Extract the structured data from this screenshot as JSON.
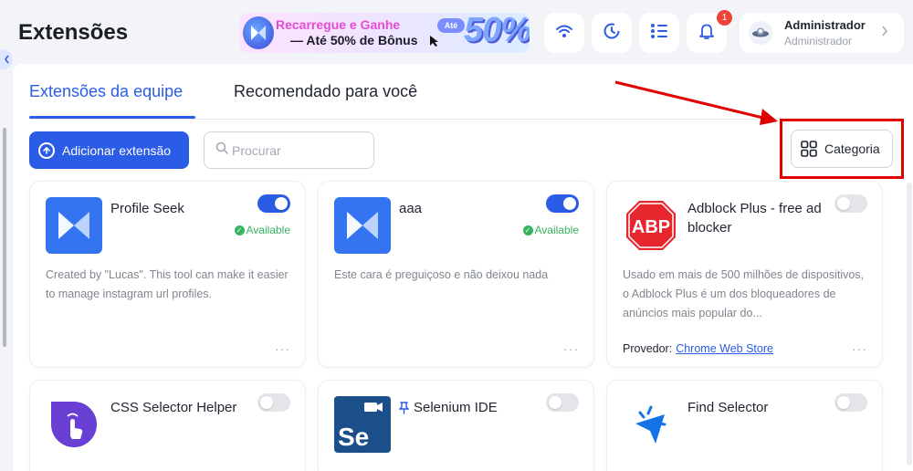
{
  "header": {
    "title": "Extensões",
    "promo": {
      "line1": "Recarregue e Ganhe",
      "line2": "— Até 50% de Bônus",
      "badge": "Até",
      "big": "50%"
    },
    "notification_count": "1",
    "user": {
      "name": "Administrador",
      "role": "Administrador"
    },
    "icons": [
      "wifi-icon",
      "sync-icon",
      "list-icon",
      "bell-icon"
    ]
  },
  "tabs": [
    {
      "label": "Extensões da equipe",
      "active": true
    },
    {
      "label": "Recomendado para você",
      "active": false
    }
  ],
  "toolbar": {
    "add_label": "Adicionar extensão",
    "search_placeholder": "Procurar",
    "category_label": "Categoria"
  },
  "cards": [
    {
      "name": "Profile Seek",
      "enabled": true,
      "status": "Available",
      "description": "Created by \"Lucas\". This tool can make it easier to manage instagram url profiles.",
      "more": "···"
    },
    {
      "name": "aaa",
      "enabled": true,
      "status": "Available",
      "description": "Este cara é preguiçoso e não deixou nada",
      "more": "···"
    },
    {
      "name": "Adblock Plus - free ad blocker",
      "enabled": false,
      "description": "Usado em mais de 500 milhões de dispositivos, o Adblock Plus é um dos bloqueadores de anúncios mais popular do...",
      "provider_label": "Provedor:",
      "provider_value": "Chrome Web Store",
      "logo_text": "ABP",
      "more": "···"
    },
    {
      "name": "CSS Selector Helper",
      "enabled": false
    },
    {
      "name": "Selenium IDE",
      "enabled": false,
      "logo_text": "Se"
    },
    {
      "name": "Find Selector",
      "enabled": false
    }
  ],
  "colors": {
    "accent": "#2b5ce6",
    "available": "#38b45f",
    "highlight": "#e00000",
    "notification": "#f04438"
  }
}
